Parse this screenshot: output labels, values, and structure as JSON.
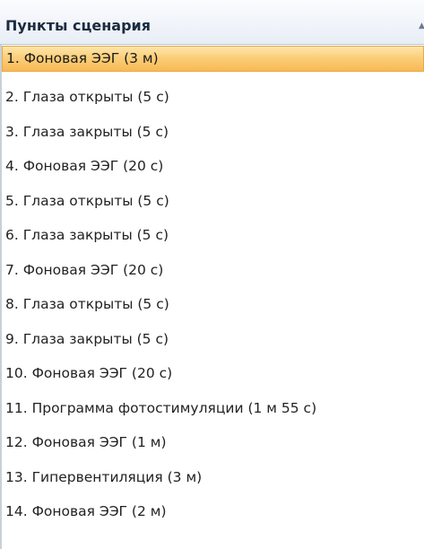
{
  "header": {
    "title": "Пункты сценария",
    "sort_icon": "sort-ascending-icon"
  },
  "colors": {
    "selected_background": "#fbcf7a",
    "header_background": "#e8eef6"
  },
  "items": [
    {
      "label": "1. Фоновая ЭЭГ (3 м)",
      "selected": true
    },
    {
      "label": "2. Глаза открыты (5 с)"
    },
    {
      "label": "3. Глаза закрыты (5 с)"
    },
    {
      "label": "4. Фоновая ЭЭГ (20 с)"
    },
    {
      "label": "5. Глаза открыты (5 с)"
    },
    {
      "label": "6. Глаза закрыты (5 с)"
    },
    {
      "label": "7. Фоновая ЭЭГ (20 с)"
    },
    {
      "label": "8. Глаза открыты (5 с)"
    },
    {
      "label": "9. Глаза закрыты (5 с)"
    },
    {
      "label": "10. Фоновая ЭЭГ (20 с)"
    },
    {
      "label": "11. Программа фотостимуляции (1 м 55 с)"
    },
    {
      "label": "12. Фоновая ЭЭГ (1 м)"
    },
    {
      "label": "13. Гипервентиляция (3 м)"
    },
    {
      "label": "14. Фоновая ЭЭГ (2 м)"
    }
  ]
}
